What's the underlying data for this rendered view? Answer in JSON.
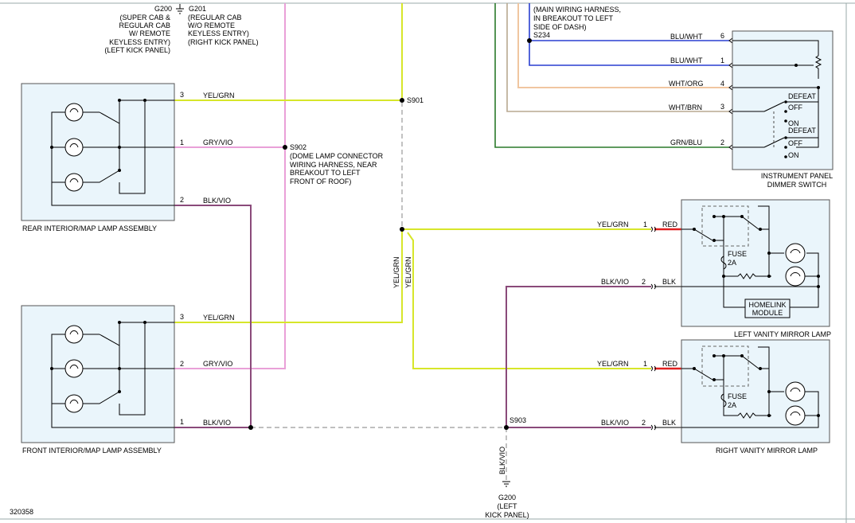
{
  "diagram_id": "320358",
  "grounds": {
    "g200_top": {
      "id": "G200",
      "desc": [
        "(SUPER CAB &",
        "REGULAR CAB",
        "W/ REMOTE",
        "KEYLESS ENTRY)",
        "(LEFT KICK PANEL)"
      ]
    },
    "g201_top": {
      "id": "G201",
      "desc": [
        "(REGULAR CAB",
        "W/O REMOTE",
        "KEYLESS ENTRY)",
        "(RIGHT KICK PANEL)"
      ]
    },
    "g200_bottom": {
      "id": "G200",
      "desc": [
        "(LEFT",
        "KICK PANEL)"
      ]
    }
  },
  "splices": {
    "s234": {
      "id": "S234",
      "desc": [
        "(MAIN WIRING HARNESS,",
        "IN BREAKOUT TO LEFT",
        "SIDE OF DASH)"
      ]
    },
    "s901": {
      "id": "S901"
    },
    "s902": {
      "id": "S902",
      "desc": [
        "(DOME LAMP CONNECTOR",
        "WIRING HARNESS, NEAR",
        "BREAKOUT TO LEFT",
        "FRONT OF ROOF)"
      ]
    },
    "s903": {
      "id": "S903"
    }
  },
  "components": {
    "rear_lamp": "REAR INTERIOR/MAP LAMP ASSEMBLY",
    "front_lamp": "FRONT INTERIOR/MAP LAMP ASSEMBLY",
    "dimmer": [
      "INSTRUMENT PANEL",
      "DIMMER SWITCH"
    ],
    "left_vanity": "LEFT VANITY MIRROR LAMP",
    "right_vanity": "RIGHT VANITY MIRROR LAMP",
    "homelink": [
      "HOMELINK",
      "MODULE"
    ]
  },
  "wires": {
    "yel_grn": "YEL/GRN",
    "gry_vio": "GRY/VIO",
    "blk_vio": "BLK/VIO",
    "blu_wht": "BLU/WHT",
    "wht_org": "WHT/ORG",
    "wht_brn": "WHT/BRN",
    "grn_blu": "GRN/BLU",
    "red": "RED",
    "blk": "BLK"
  },
  "pins": {
    "p1": "1",
    "p2": "2",
    "p3": "3",
    "p4": "4",
    "p6": "6"
  },
  "switch_labels": {
    "defeat": "DEFEAT",
    "off": "OFF",
    "on": "ON"
  },
  "fuse": {
    "label": "FUSE",
    "rating": "2A"
  }
}
